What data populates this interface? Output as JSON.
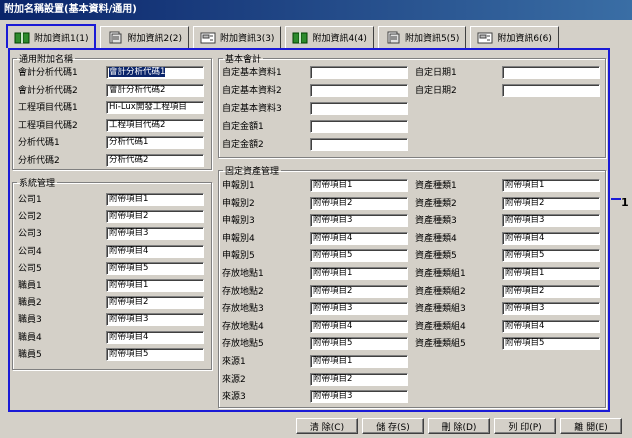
{
  "window": {
    "title": "附加名稱設置(基本資料/通用)"
  },
  "tabs": [
    {
      "label": "附加資訊1(1)",
      "icon": "book-icon",
      "active": true
    },
    {
      "label": "附加資訊2(2)",
      "icon": "document-icon",
      "active": false
    },
    {
      "label": "附加資訊3(3)",
      "icon": "folder-icon",
      "active": false
    },
    {
      "label": "附加資訊4(4)",
      "icon": "book-icon",
      "active": false
    },
    {
      "label": "附加資訊5(5)",
      "icon": "document-icon",
      "active": false
    },
    {
      "label": "附加資訊6(6)",
      "icon": "folder-icon",
      "active": false
    }
  ],
  "annotation_number": "1",
  "general": {
    "legend": "通用附加名稱",
    "rows": [
      {
        "label": "會計分析代碼1",
        "value": "會計分析代碼1",
        "selected": true
      },
      {
        "label": "會計分析代碼2",
        "value": "會計分析代碼2"
      },
      {
        "label": "工程項目代碼1",
        "value": "Hi-Lux開發工程項目"
      },
      {
        "label": "工程項目代碼2",
        "value": "工程項目代碼2"
      },
      {
        "label": "分析代碼1",
        "value": "分析代碼1"
      },
      {
        "label": "分析代碼2",
        "value": "分析代碼2"
      }
    ]
  },
  "system": {
    "legend": "系統管理",
    "rows": [
      {
        "label": "公司1",
        "value": "附帶項目1"
      },
      {
        "label": "公司2",
        "value": "附帶項目2"
      },
      {
        "label": "公司3",
        "value": "附帶項目3"
      },
      {
        "label": "公司4",
        "value": "附帶項目4"
      },
      {
        "label": "公司5",
        "value": "附帶項目5"
      },
      {
        "label": "職員1",
        "value": "附帶項目1"
      },
      {
        "label": "職員2",
        "value": "附帶項目2"
      },
      {
        "label": "職員3",
        "value": "附帶項目3"
      },
      {
        "label": "職員4",
        "value": "附帶項目4"
      },
      {
        "label": "職員5",
        "value": "附帶項目5"
      }
    ]
  },
  "accounting": {
    "legend": "基本會計",
    "left": [
      {
        "label": "自定基本資料1",
        "value": ""
      },
      {
        "label": "自定基本資料2",
        "value": ""
      },
      {
        "label": "自定基本資料3",
        "value": ""
      },
      {
        "label": "自定金額1",
        "value": ""
      },
      {
        "label": "自定金額2",
        "value": ""
      }
    ],
    "right": [
      {
        "label": "自定日期1",
        "value": ""
      },
      {
        "label": "自定日期2",
        "value": ""
      }
    ]
  },
  "assets": {
    "legend": "固定資產管理",
    "left": [
      {
        "label": "申報別1",
        "value": "附帶項目1"
      },
      {
        "label": "申報別2",
        "value": "附帶項目2"
      },
      {
        "label": "申報別3",
        "value": "附帶項目3"
      },
      {
        "label": "申報別4",
        "value": "附帶項目4"
      },
      {
        "label": "申報別5",
        "value": "附帶項目5"
      },
      {
        "label": "存放地點1",
        "value": "附帶項目1"
      },
      {
        "label": "存放地點2",
        "value": "附帶項目2"
      },
      {
        "label": "存放地點3",
        "value": "附帶項目3"
      },
      {
        "label": "存放地點4",
        "value": "附帶項目4"
      },
      {
        "label": "存放地點5",
        "value": "附帶項目5"
      },
      {
        "label": "來源1",
        "value": "附帶項目1"
      },
      {
        "label": "來源2",
        "value": "附帶項目2"
      },
      {
        "label": "來源3",
        "value": "附帶項目3"
      }
    ],
    "right": [
      {
        "label": "資產種類1",
        "value": "附帶項目1"
      },
      {
        "label": "資產種類2",
        "value": "附帶項目2"
      },
      {
        "label": "資產種類3",
        "value": "附帶項目3"
      },
      {
        "label": "資產種類4",
        "value": "附帶項目4"
      },
      {
        "label": "資產種類5",
        "value": "附帶項目5"
      },
      {
        "label": "資產種類組1",
        "value": "附帶項目1"
      },
      {
        "label": "資產種類組2",
        "value": "附帶項目2"
      },
      {
        "label": "資產種類組3",
        "value": "附帶項目3"
      },
      {
        "label": "資產種類組4",
        "value": "附帶項目4"
      },
      {
        "label": "資產種類組5",
        "value": "附帶項目5"
      }
    ]
  },
  "buttons": {
    "clear": "清 除(C)",
    "save": "儲 存(S)",
    "delete": "刪 除(D)",
    "print": "列 印(P)",
    "close": "離 開(E)"
  }
}
